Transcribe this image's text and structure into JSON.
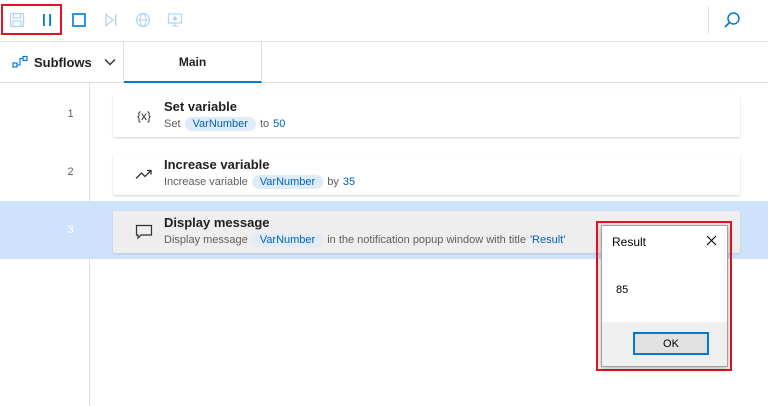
{
  "toolbar": {
    "buttons": [
      {
        "name": "save",
        "icon": "save-icon",
        "enabled": false
      },
      {
        "name": "pause",
        "icon": "pause-icon",
        "enabled": true
      },
      {
        "name": "stop",
        "icon": "stop-icon",
        "enabled": true
      },
      {
        "name": "run-next-action",
        "icon": "run-next-action-icon",
        "enabled": false
      },
      {
        "name": "web-recorder",
        "icon": "globe-icon",
        "enabled": false
      },
      {
        "name": "desktop-recorder",
        "icon": "monitor-recorder-icon",
        "enabled": false
      },
      {
        "name": "search",
        "icon": "search-icon",
        "enabled": true
      }
    ],
    "colors": {
      "active": "#0078d4",
      "disabled": "#b3d4f0",
      "highlight": "#e81123"
    }
  },
  "tabs": {
    "subflows_label": "Subflows",
    "main_label": "Main"
  },
  "actions": [
    {
      "line": "1",
      "icon": "variable-braces-icon",
      "icon_text": "{x}",
      "title": "Set variable",
      "desc_prefix": "Set",
      "variable": "VarNumber",
      "desc_mid": "to",
      "value": "50",
      "desc_suffix": "",
      "value2": ""
    },
    {
      "line": "2",
      "icon": "trending-up-icon",
      "icon_text": "",
      "title": "Increase variable",
      "desc_prefix": "Increase variable",
      "variable": "VarNumber",
      "desc_mid": "by",
      "value": "35",
      "desc_suffix": "",
      "value2": ""
    },
    {
      "line": "3",
      "icon": "message-icon",
      "icon_text": "",
      "title": "Display message",
      "desc_prefix": "Display message",
      "variable": "VarNumber",
      "desc_mid": "in the notification popup window with title",
      "value": "'Result'",
      "desc_suffix": "",
      "value2": ""
    }
  ],
  "selected_line": "3",
  "dialog": {
    "title": "Result",
    "message": "85",
    "ok_label": "OK"
  }
}
